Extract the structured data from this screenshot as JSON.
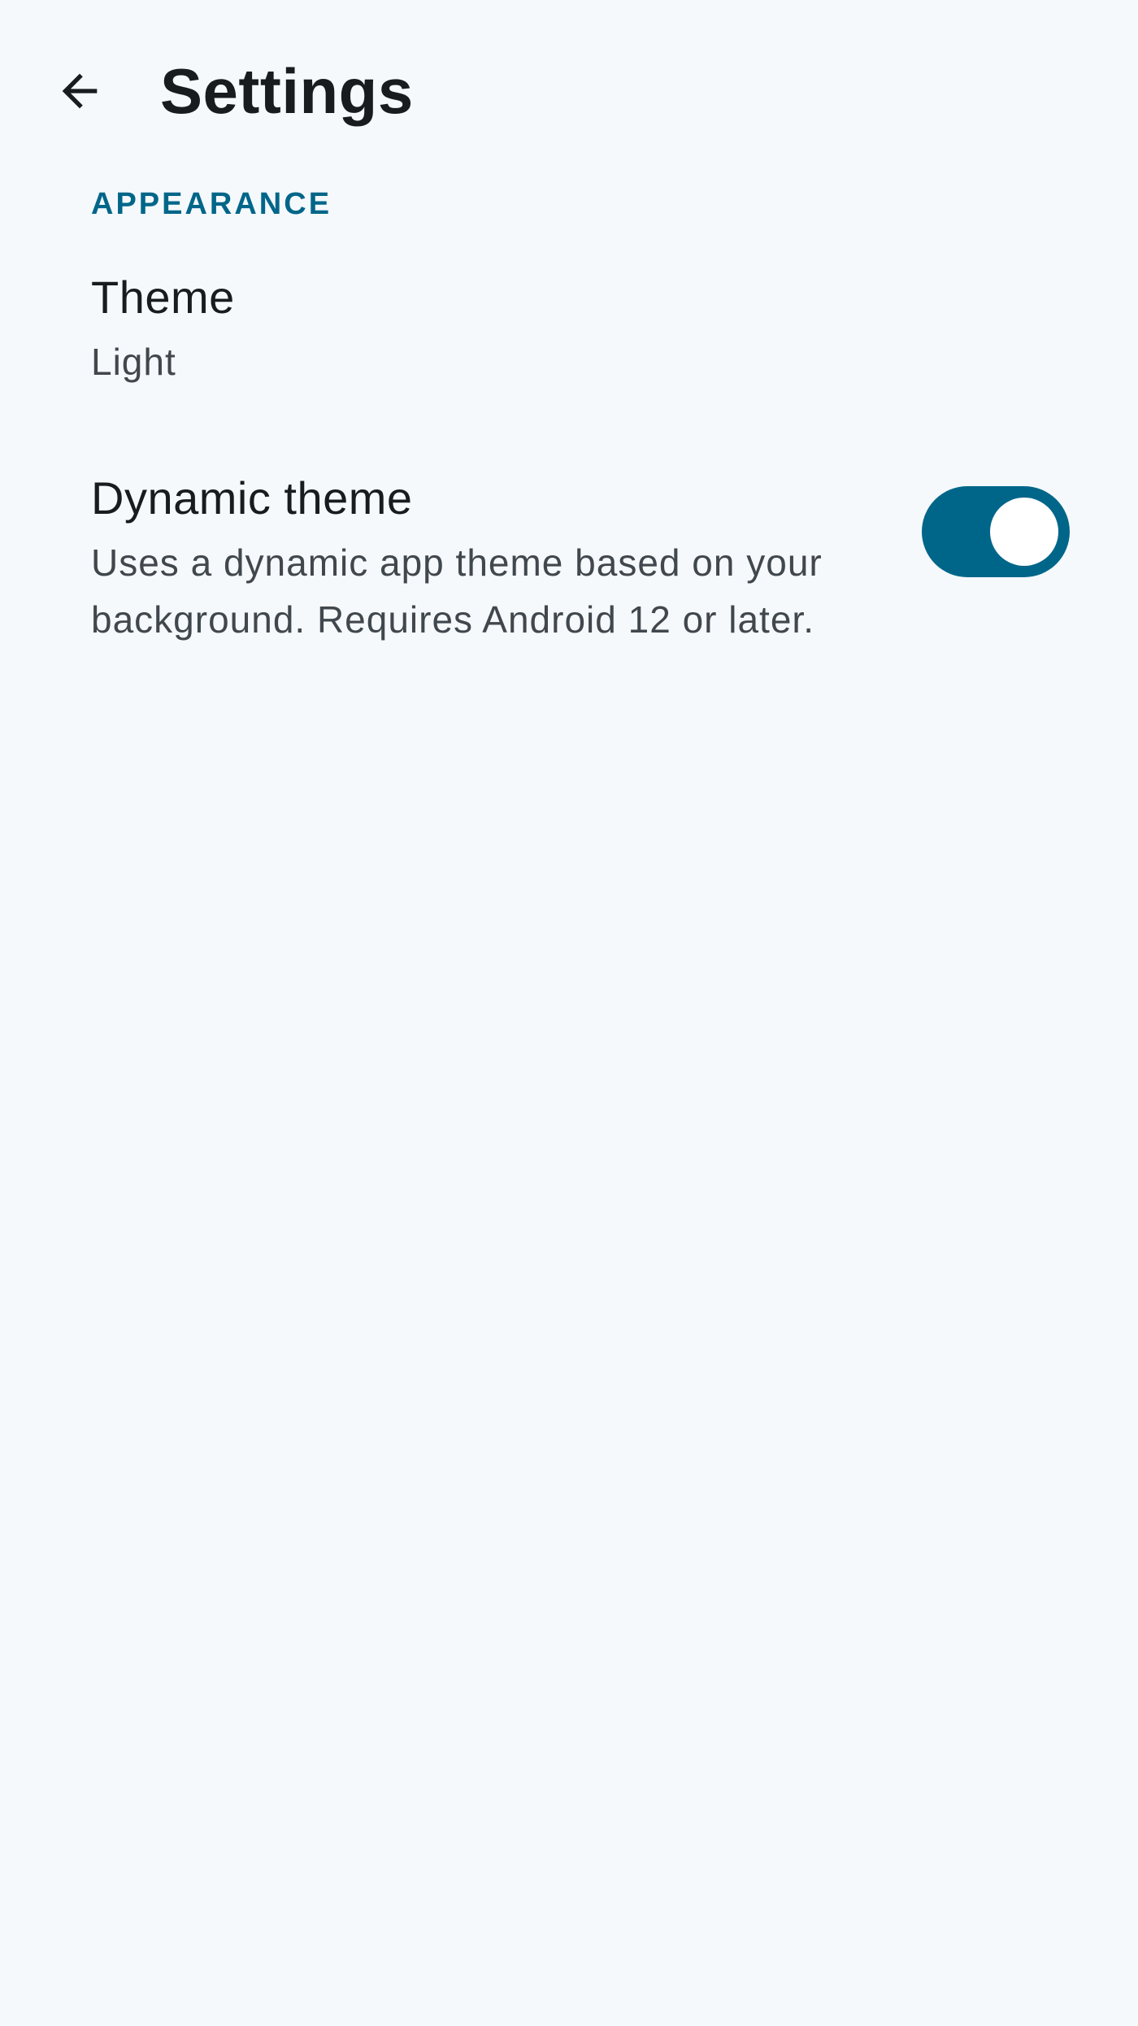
{
  "header": {
    "back_icon": "arrow-left-icon",
    "title": "Settings"
  },
  "sections": [
    {
      "header": "APPEARANCE",
      "items": [
        {
          "title": "Theme",
          "summary": "Light"
        },
        {
          "title": "Dynamic theme",
          "summary": "Uses a dynamic app theme based on your background. Requires Android 12 or later.",
          "control": "switch",
          "checked": true
        }
      ]
    }
  ],
  "colors": {
    "background": "#f5f9fc",
    "accent": "#006689",
    "text_primary": "#191c1e",
    "text_secondary": "#41484d"
  }
}
